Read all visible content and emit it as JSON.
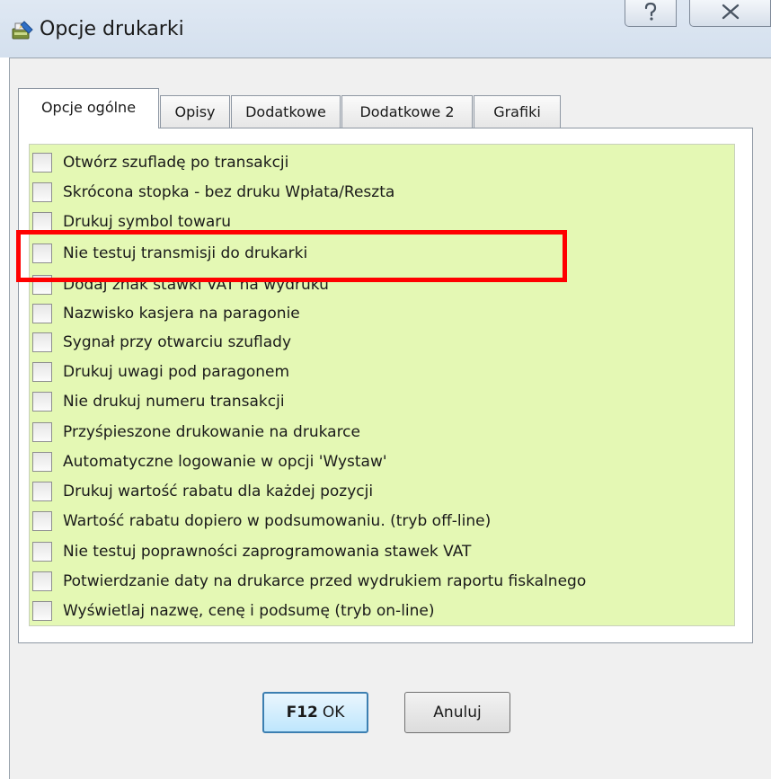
{
  "window": {
    "title": "Opcje drukarki",
    "help_button": "?",
    "close_button": "✕"
  },
  "tabs": [
    {
      "label": "Opcje ogólne",
      "active": true
    },
    {
      "label": "Opisy",
      "active": false
    },
    {
      "label": "Dodatkowe",
      "active": false
    },
    {
      "label": "Dodatkowe 2",
      "active": false
    },
    {
      "label": "Grafiki",
      "active": false
    }
  ],
  "options": [
    {
      "label": "Otwórz szufladę po transakcji",
      "checked": false
    },
    {
      "label": "Skrócona stopka - bez druku Wpłata/Reszta",
      "checked": false
    },
    {
      "label": "Drukuj symbol towaru",
      "checked": false
    },
    {
      "label": "Nie testuj transmisji do drukarki",
      "checked": false
    },
    {
      "label": "Dodaj znak stawki VAT na wydruku",
      "checked": false
    },
    {
      "label": "Nazwisko kasjera na paragonie",
      "checked": false
    },
    {
      "label": "Sygnał przy otwarciu szuflady",
      "checked": false
    },
    {
      "label": "Drukuj uwagi pod paragonem",
      "checked": false
    },
    {
      "label": "Nie drukuj numeru transakcji",
      "checked": false
    },
    {
      "label": "Przyśpieszone drukowanie na drukarce",
      "checked": false
    },
    {
      "label": "Automatyczne logowanie w opcji 'Wystaw'",
      "checked": false
    },
    {
      "label": "Drukuj wartość rabatu dla każdej pozycji",
      "checked": false
    },
    {
      "label": "Wartość rabatu dopiero w podsumowaniu. (tryb off-line)",
      "checked": false
    },
    {
      "label": "Nie testuj poprawności zaprogramowania stawek VAT",
      "checked": false
    },
    {
      "label": "Potwierdzanie daty na drukarce przed wydrukiem raportu fiskalnego",
      "checked": false
    },
    {
      "label": "Wyświetlaj nazwę, cenę i podsumę (tryb on-line)",
      "checked": false
    }
  ],
  "buttons": {
    "ok_key": "F12",
    "ok_label": "OK",
    "cancel_label": "Anuluj"
  },
  "colors": {
    "list_background": "#e4f8b4",
    "highlight": "#ff0000",
    "ok_border": "#3c7fb1"
  }
}
